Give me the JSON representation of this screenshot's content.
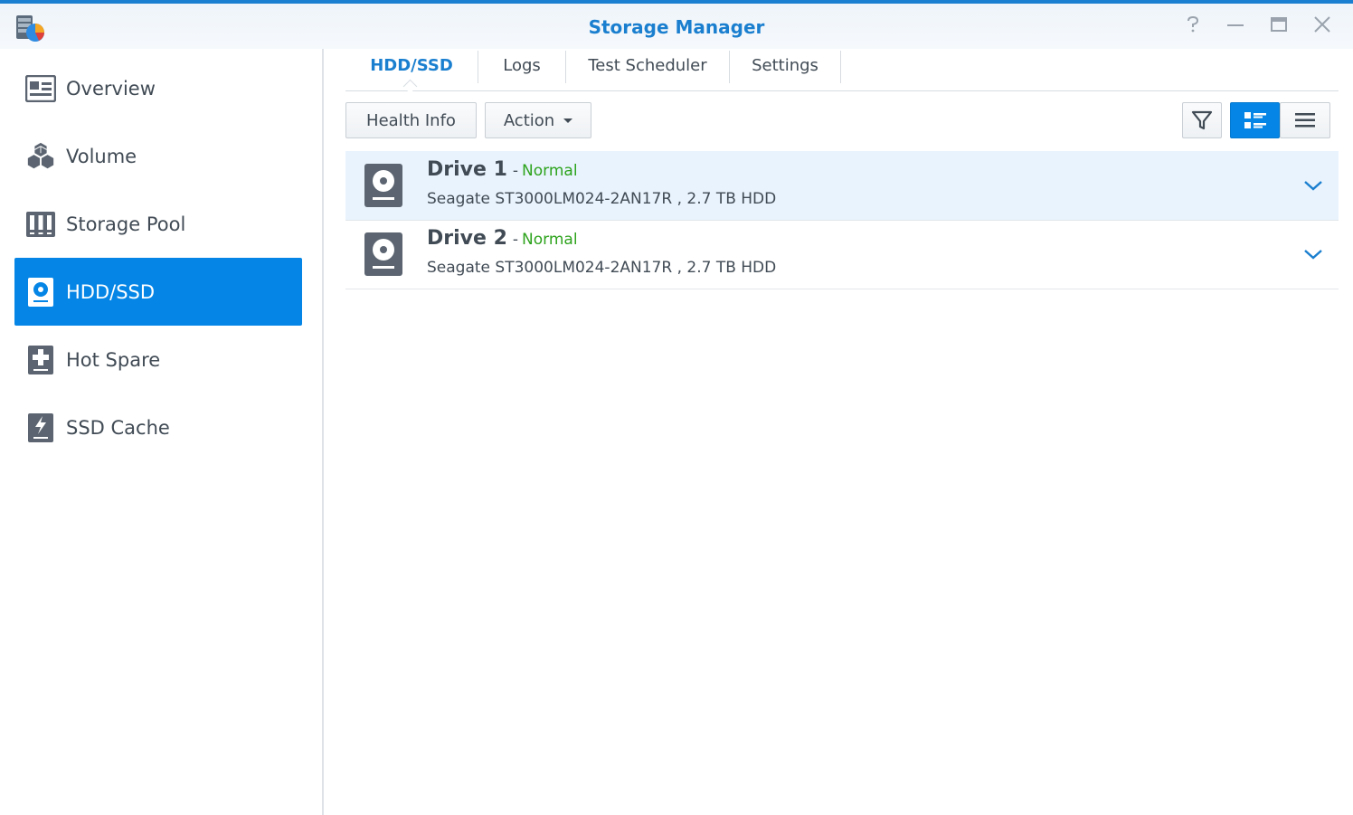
{
  "window": {
    "title": "Storage Manager",
    "controls": [
      "help-icon",
      "minimize-icon",
      "maximize-icon",
      "close-icon"
    ]
  },
  "sidebar": {
    "items": [
      {
        "label": "Overview",
        "icon": "overview-icon",
        "active": false
      },
      {
        "label": "Volume",
        "icon": "volume-icon",
        "active": false
      },
      {
        "label": "Storage Pool",
        "icon": "storage-pool-icon",
        "active": false
      },
      {
        "label": "HDD/SSD",
        "icon": "hdd-icon",
        "active": true
      },
      {
        "label": "Hot Spare",
        "icon": "hot-spare-icon",
        "active": false
      },
      {
        "label": "SSD Cache",
        "icon": "ssd-cache-icon",
        "active": false
      }
    ]
  },
  "tabs": [
    {
      "label": "HDD/SSD",
      "active": true
    },
    {
      "label": "Logs",
      "active": false
    },
    {
      "label": "Test Scheduler",
      "active": false
    },
    {
      "label": "Settings",
      "active": false
    }
  ],
  "toolbar": {
    "health_info_label": "Health Info",
    "action_label": "Action",
    "view_mode": "detail"
  },
  "drives": [
    {
      "name": "Drive 1",
      "separator": "-",
      "status": "Normal",
      "description": "Seagate ST3000LM024-2AN17R , 2.7 TB HDD",
      "highlighted": true
    },
    {
      "name": "Drive 2",
      "separator": "-",
      "status": "Normal",
      "description": "Seagate ST3000LM024-2AN17R , 2.7 TB HDD",
      "highlighted": false
    }
  ],
  "colors": {
    "accent": "#0586e6",
    "title": "#1b7fcf",
    "status_normal": "#2ea31d",
    "row_highlight": "#e8f3fd"
  }
}
